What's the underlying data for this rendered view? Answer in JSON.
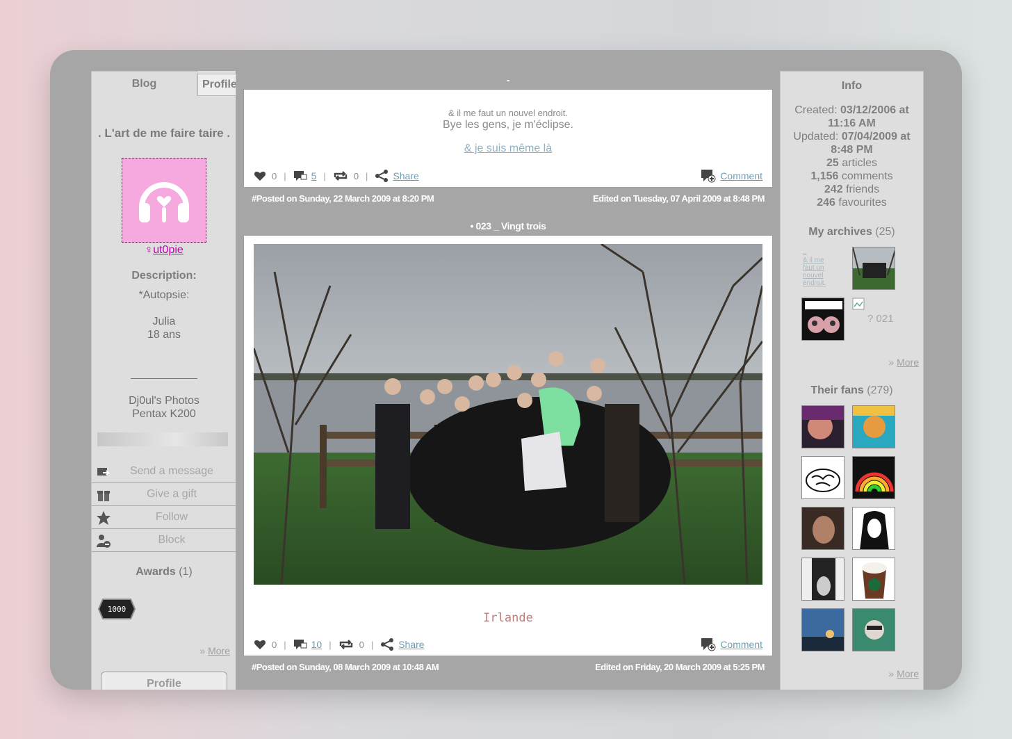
{
  "tabs": {
    "blog": "Blog",
    "profile": "Profile"
  },
  "blog_title": ". L'art de me faire taire .",
  "user": {
    "gender_icon": "female-icon",
    "name": "ut0pie"
  },
  "description": {
    "label": "Description:",
    "line1": "*Autopsie:",
    "line2": "Julia",
    "line3": "18 ans",
    "line4": "Dj0ul's Photos",
    "line5": "Pentax K200"
  },
  "actions": {
    "send_message": "Send a message",
    "give_gift": "Give a gift",
    "follow": "Follow",
    "block": "Block"
  },
  "awards": {
    "label": "Awards",
    "count": "(1)",
    "badge_text": "1000"
  },
  "more": "More",
  "more_prefix": "»",
  "profile_button": "Profile",
  "posts": [
    {
      "title": "-",
      "small_line": "& il me faut un nouvel endroit.",
      "big_line": "Bye les gens, je m'éclipse.",
      "link": "& je suis même là",
      "likes": "0",
      "comments": "5",
      "reblogs": "0",
      "share": "Share",
      "comment": "Comment",
      "posted": "#Posted on Sunday, 22 March 2009 at 8:20 PM",
      "edited": "Edited on Tuesday, 07 April 2009 at 8:48 PM"
    },
    {
      "title": "• 023 _ Vingt trois",
      "caption": "Irlande",
      "likes": "0",
      "comments": "10",
      "reblogs": "0",
      "share": "Share",
      "comment": "Comment",
      "posted": "#Posted on Sunday, 08 March 2009 at 10:48 AM",
      "edited": "Edited on Friday, 20 March 2009 at 5:25 PM"
    }
  ],
  "info": {
    "title": "Info",
    "created_label": "Created:",
    "created_date": "03/12/2006 at",
    "created_time": "11:16 AM",
    "updated_label": "Updated:",
    "updated_date": "07/04/2009 at",
    "updated_time": "8:48 PM",
    "articles_num": "25",
    "articles_label": "articles",
    "comments_num": "1,156",
    "comments_label": "comments",
    "friends_num": "242",
    "friends_label": "friends",
    "favourites_num": "246",
    "favourites_label": "favourites"
  },
  "archives": {
    "label": "My archives",
    "count": "(25)",
    "thumb1_dots": "..",
    "thumb1_text": "& il me faut un nouvel endroit.",
    "thumb4_text": "? 021"
  },
  "fans": {
    "label": "Their fans",
    "count": "(279)"
  },
  "colors": {
    "accent_link": "#6a9fb8",
    "user_link": "#c400b0",
    "avatar_bg": "#f6a9de",
    "caption": "#c07c7c"
  }
}
